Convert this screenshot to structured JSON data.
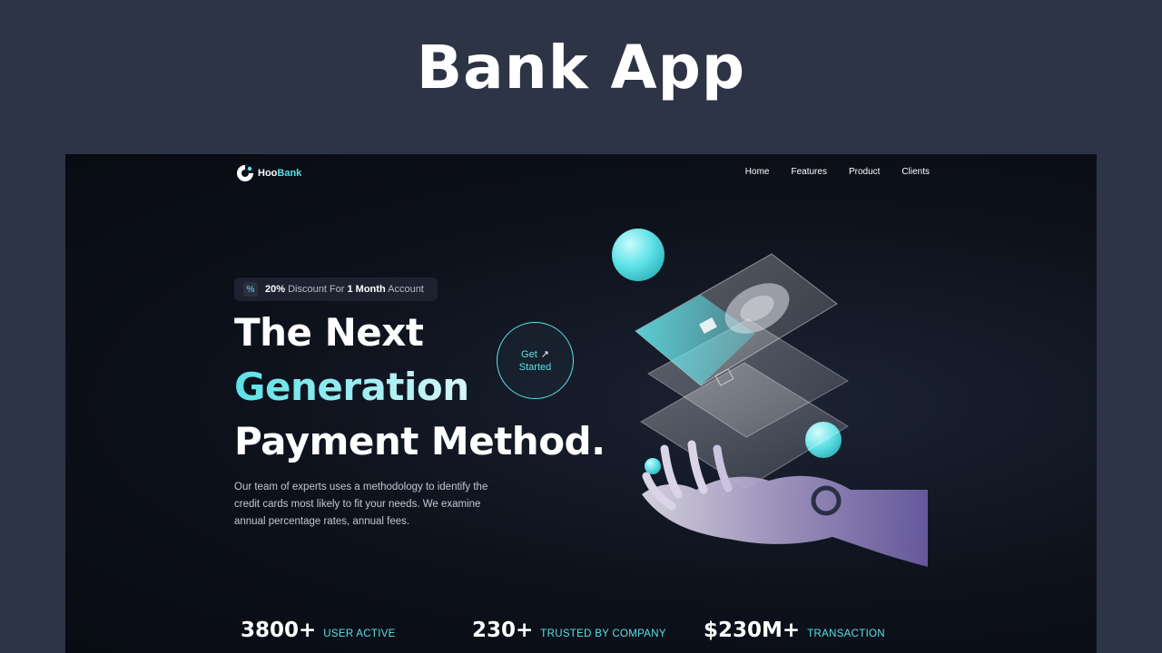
{
  "banner": {
    "title": "Bank App"
  },
  "navbar": {
    "logo_part1": "Hoo",
    "logo_part2": "Bank",
    "items": [
      "Home",
      "Features",
      "Product",
      "Clients"
    ]
  },
  "hero": {
    "badge_strong1": "20%",
    "badge_mid": " Discount For ",
    "badge_strong2": "1 Month",
    "badge_end": " Account",
    "line1": "The Next",
    "line2": "Generation",
    "line3": "Payment Method.",
    "description": "Our team of experts uses a methodology to identify the credit cards most likely to fit your needs. We examine annual percentage rates, annual fees.",
    "cta_top": "Get",
    "cta_bottom": "Started"
  },
  "stats": [
    {
      "value": "3800+",
      "label": "USER ACTIVE"
    },
    {
      "value": "230+",
      "label": "TRUSTED BY COMPANY"
    },
    {
      "value": "$230M+",
      "label": "TRANSACTION"
    }
  ],
  "colors": {
    "accent": "#5ce1e6",
    "background": "#2d3446",
    "panel": "#0d111b"
  }
}
